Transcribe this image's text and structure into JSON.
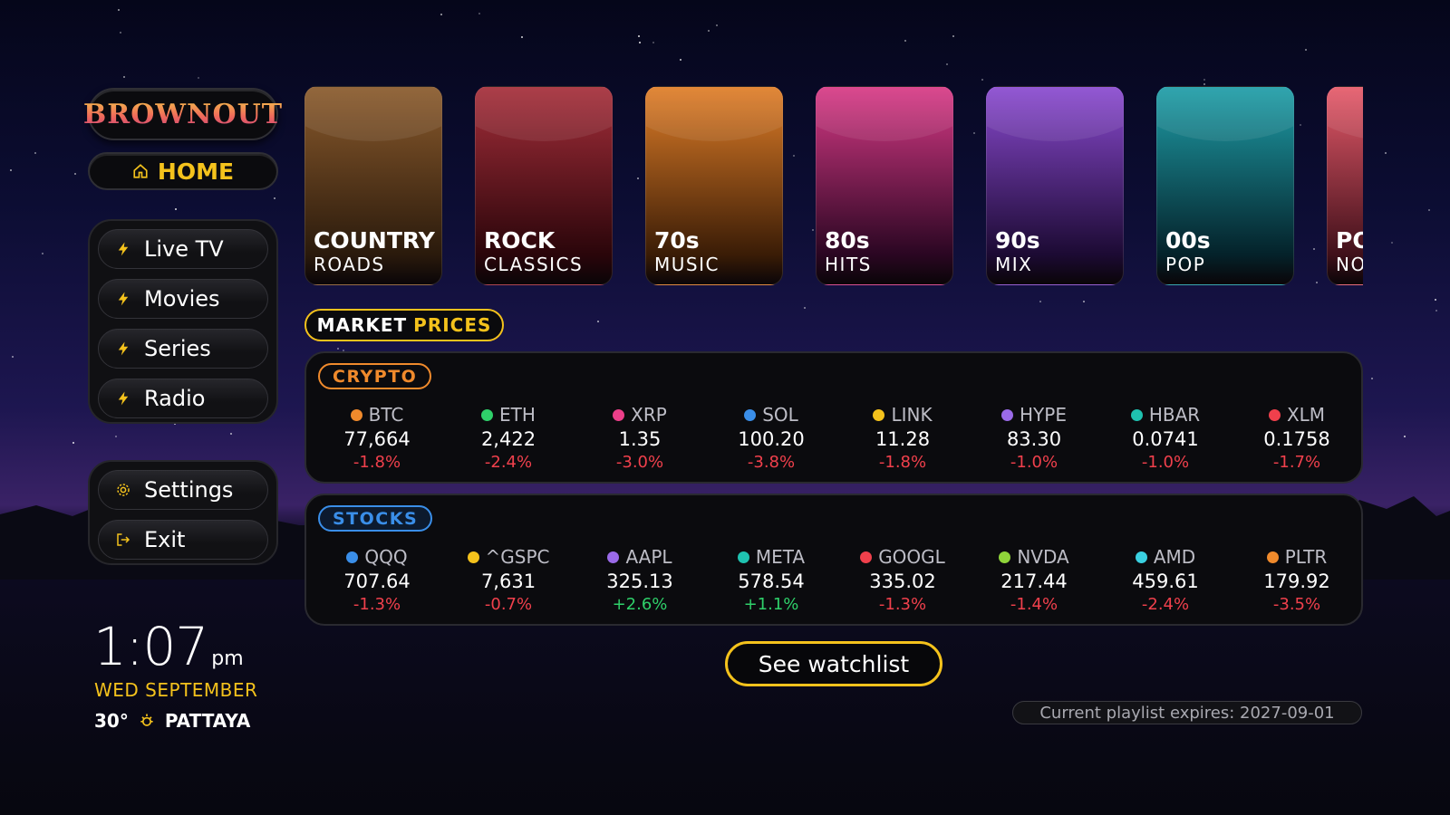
{
  "brand": {
    "logo_text": "BROWNOUT"
  },
  "home": {
    "label": "HOME",
    "icon": "home-icon"
  },
  "nav": {
    "main": [
      {
        "label": "Live TV",
        "icon": "bolt-icon"
      },
      {
        "label": "Movies",
        "icon": "bolt-icon"
      },
      {
        "label": "Series",
        "icon": "bolt-icon"
      },
      {
        "label": "Radio",
        "icon": "bolt-icon"
      }
    ],
    "system": [
      {
        "label": "Settings",
        "icon": "gear-icon"
      },
      {
        "label": "Exit",
        "icon": "exit-icon"
      }
    ]
  },
  "clock": {
    "time": "1:07",
    "ampm": "pm",
    "date": "WED SEPTEMBER",
    "temp": "30°",
    "weather_icon": "sun-icon",
    "city": "PATTAYA"
  },
  "genres": [
    {
      "line1": "COUNTRY",
      "line2": "ROADS",
      "colors": [
        "#8a5a2c",
        "#2a1a0c"
      ]
    },
    {
      "line1": "ROCK",
      "line2": "CLASSICS",
      "colors": [
        "#a52e3a",
        "#2a050a"
      ]
    },
    {
      "line1": "70s",
      "line2": "MUSIC",
      "colors": [
        "#e07e28",
        "#3a1c06"
      ]
    },
    {
      "line1": "80s",
      "line2": "HITS",
      "colors": [
        "#d83a86",
        "#2a0622"
      ]
    },
    {
      "line1": "90s",
      "line2": "MIX",
      "colors": [
        "#8a4ad0",
        "#1c0a33"
      ]
    },
    {
      "line1": "00s",
      "line2": "POP",
      "colors": [
        "#1f9ea8",
        "#04222a"
      ]
    },
    {
      "line1": "POP",
      "line2": "NOW",
      "colors": [
        "#e65a6a",
        "#40101a"
      ]
    }
  ],
  "market": {
    "label_a": "MARKET",
    "label_b": "PRICES"
  },
  "crypto": {
    "tag": "CRYPTO",
    "items": [
      {
        "sym": "BTC",
        "price": "77,664",
        "chg": "-1.8%",
        "dir": "neg",
        "color": "#f08a2c"
      },
      {
        "sym": "ETH",
        "price": "2,422",
        "chg": "-2.4%",
        "dir": "neg",
        "color": "#2fd06a"
      },
      {
        "sym": "XRP",
        "price": "1.35",
        "chg": "-3.0%",
        "dir": "neg",
        "color": "#ec3f8a"
      },
      {
        "sym": "SOL",
        "price": "100.20",
        "chg": "-3.8%",
        "dir": "neg",
        "color": "#3a8ee8"
      },
      {
        "sym": "LINK",
        "price": "11.28",
        "chg": "-1.8%",
        "dir": "neg",
        "color": "#f4c21c"
      },
      {
        "sym": "HYPE",
        "price": "83.30",
        "chg": "-1.0%",
        "dir": "neg",
        "color": "#9a6ae8"
      },
      {
        "sym": "HBAR",
        "price": "0.0741",
        "chg": "-1.0%",
        "dir": "neg",
        "color": "#1fc2b0"
      },
      {
        "sym": "XLM",
        "price": "0.1758",
        "chg": "-1.7%",
        "dir": "neg",
        "color": "#f0404c"
      }
    ]
  },
  "stocks": {
    "tag": "STOCKS",
    "items": [
      {
        "sym": "QQQ",
        "price": "707.64",
        "chg": "-1.3%",
        "dir": "neg",
        "color": "#3a8ee8"
      },
      {
        "sym": "^GSPC",
        "price": "7,631",
        "chg": "-0.7%",
        "dir": "neg",
        "color": "#f4c21c"
      },
      {
        "sym": "AAPL",
        "price": "325.13",
        "chg": "+2.6%",
        "dir": "pos",
        "color": "#9a6ae8"
      },
      {
        "sym": "META",
        "price": "578.54",
        "chg": "+1.1%",
        "dir": "pos",
        "color": "#1fc2b0"
      },
      {
        "sym": "GOOGL",
        "price": "335.02",
        "chg": "-1.3%",
        "dir": "neg",
        "color": "#f0404c"
      },
      {
        "sym": "NVDA",
        "price": "217.44",
        "chg": "-1.4%",
        "dir": "neg",
        "color": "#8fd43a"
      },
      {
        "sym": "AMD",
        "price": "459.61",
        "chg": "-2.4%",
        "dir": "neg",
        "color": "#3ad0e0"
      },
      {
        "sym": "PLTR",
        "price": "179.92",
        "chg": "-3.5%",
        "dir": "neg",
        "color": "#f08a2c"
      }
    ]
  },
  "watchlist_button": "See watchlist",
  "expiry_text": "Current playlist expires: 2027-09-01"
}
